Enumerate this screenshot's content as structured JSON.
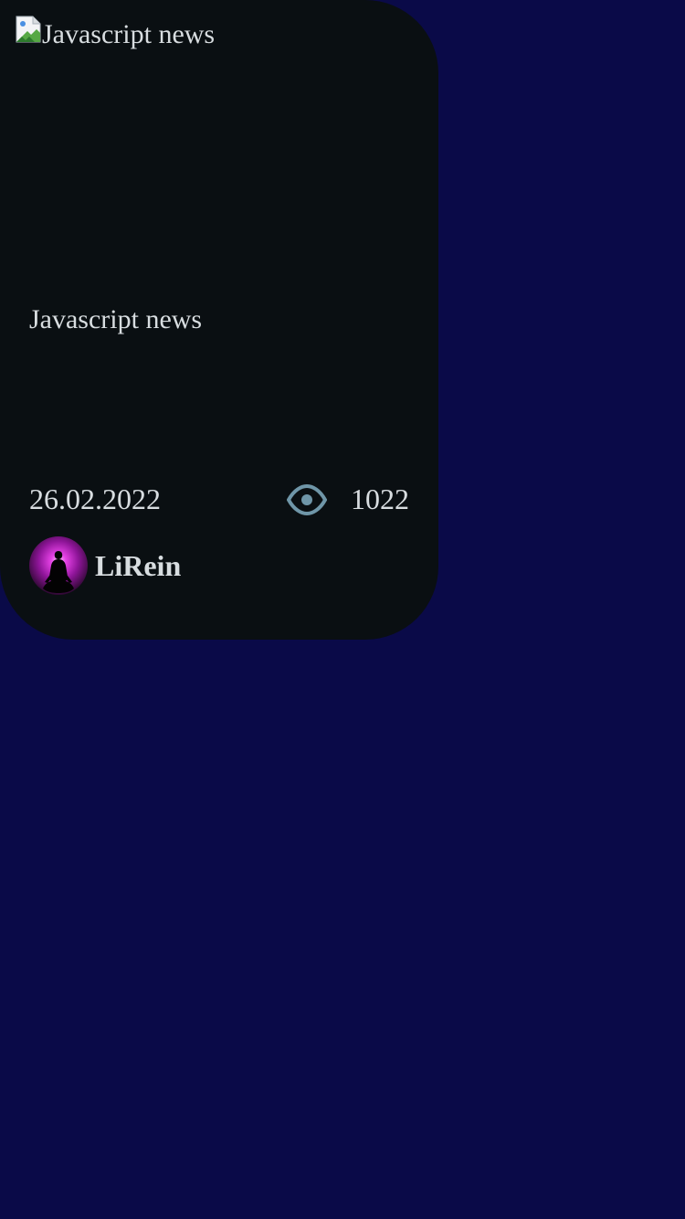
{
  "card": {
    "image_alt": "Javascript news",
    "title": "Javascript news",
    "date": "26.02.2022",
    "views": "1022",
    "author": "LiRein"
  },
  "colors": {
    "background": "#0a0a48",
    "card": "#0a0f12",
    "text": "#d8dde0",
    "eye_icon": "#6f96a8",
    "avatar_glow": "#d22ad2"
  },
  "icons": {
    "broken_image": "broken-image-icon",
    "views": "eye-icon",
    "avatar": "meditating-figure-avatar"
  }
}
